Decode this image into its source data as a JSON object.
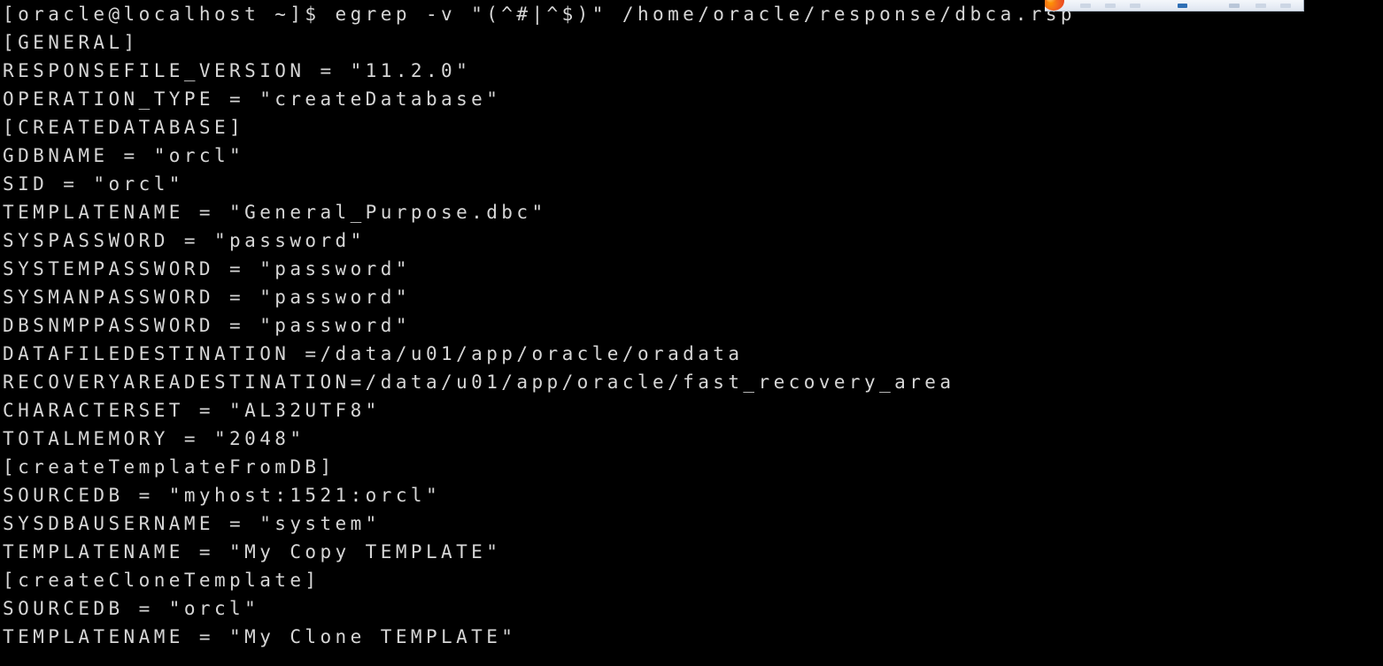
{
  "window": {
    "type": "terminal-emulator",
    "background_color": "#000000",
    "text_color": "#d6d6d6"
  },
  "top_strip": {
    "description": "partially visible browser toolbar at top right edge",
    "logo_icon": "firefox-logo-icon",
    "background_color": "#e9eef6",
    "accent_color": "#2f6fb5"
  },
  "terminal": {
    "prompt": "[oracle@localhost ~]$",
    "command": "egrep -v \"(^#|^$)\" /home/oracle/response/dbca.rsp",
    "lines": [
      "[oracle@localhost ~]$ egrep -v \"(^#|^$)\" /home/oracle/response/dbca.rsp",
      "[GENERAL]",
      "RESPONSEFILE_VERSION = \"11.2.0\"",
      "OPERATION_TYPE = \"createDatabase\"",
      "[CREATEDATABASE]",
      "GDBNAME = \"orcl\"",
      "SID = \"orcl\"",
      "TEMPLATENAME = \"General_Purpose.dbc\"",
      "SYSPASSWORD = \"password\"",
      "SYSTEMPASSWORD = \"password\"",
      "SYSMANPASSWORD = \"password\"",
      "DBSNMPPASSWORD = \"password\"",
      "DATAFILEDESTINATION =/data/u01/app/oracle/oradata",
      "RECOVERYAREADESTINATION=/data/u01/app/oracle/fast_recovery_area",
      "CHARACTERSET = \"AL32UTF8\"",
      "TOTALMEMORY = \"2048\"",
      "[createTemplateFromDB]",
      "SOURCEDB = \"myhost:1521:orcl\"",
      "SYSDBAUSERNAME = \"system\"",
      "TEMPLATENAME = \"My Copy TEMPLATE\"",
      "[createCloneTemplate]",
      "SOURCEDB = \"orcl\"",
      "TEMPLATENAME = \"My Clone TEMPLATE\""
    ]
  }
}
